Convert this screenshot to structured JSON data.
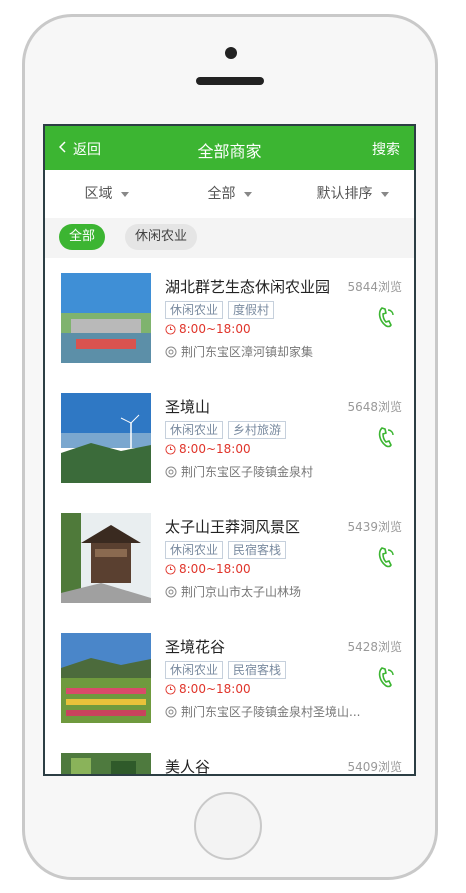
{
  "header": {
    "back_label": "返回",
    "title": "全部商家",
    "search_label": "搜索"
  },
  "filters": {
    "area": "区域",
    "category": "全部",
    "sort": "默认排序"
  },
  "tags": {
    "all": "全部",
    "leisure": "休闲农业"
  },
  "colors": {
    "brand": "#3cb532",
    "hours": "#e0352b"
  },
  "listings": [
    {
      "name": "湖北群艺生态休闲农业园",
      "views": "5844浏览",
      "tags": [
        "休闲农业",
        "度假村"
      ],
      "hours": "8:00~18:00",
      "address": "荆门东宝区漳河镇却家集"
    },
    {
      "name": "圣境山",
      "views": "5648浏览",
      "tags": [
        "休闲农业",
        "乡村旅游"
      ],
      "hours": "8:00~18:00",
      "address": "荆门东宝区子陵镇金泉村"
    },
    {
      "name": "太子山王莽洞风景区",
      "views": "5439浏览",
      "tags": [
        "休闲农业",
        "民宿客栈"
      ],
      "hours": "8:00~18:00",
      "address": "荆门京山市太子山林场"
    },
    {
      "name": "圣境花谷",
      "views": "5428浏览",
      "tags": [
        "休闲农业",
        "民宿客栈"
      ],
      "hours": "8:00~18:00",
      "address": "荆门东宝区子陵镇金泉村圣境山..."
    },
    {
      "name": "美人谷",
      "views": "5409浏览"
    }
  ]
}
